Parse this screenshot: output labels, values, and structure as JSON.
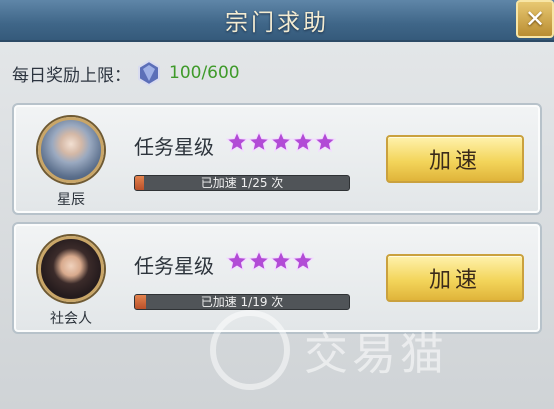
{
  "dialog": {
    "title": "宗门求助",
    "close_label": "✕"
  },
  "reward": {
    "label": "每日奖励上限：",
    "value": "100/600",
    "icon": "crystal-icon",
    "value_color": "#3f9a2a"
  },
  "tasks": [
    {
      "name": "星辰",
      "task_label": "任务星级",
      "stars": 5,
      "progress_text": "已加速 1/25 次",
      "progress": 0.04,
      "button_label": "加速"
    },
    {
      "name": "社会人",
      "task_label": "任务星级",
      "stars": 4,
      "progress_text": "已加速 1/19 次",
      "progress": 0.05,
      "button_label": "加速"
    }
  ],
  "watermark": {
    "text": "交易猫"
  },
  "colors": {
    "title_bar": "#4f7598",
    "button_gold": "#f3d55b",
    "star": "#b24bd6"
  }
}
